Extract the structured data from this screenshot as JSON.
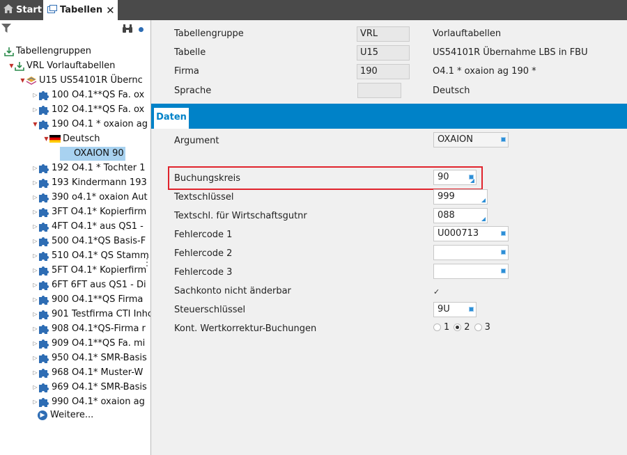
{
  "tabs": [
    {
      "label": "Start"
    },
    {
      "label": "Tabellen"
    }
  ],
  "tree": {
    "root": "Tabellengruppen",
    "vrl": "VRL  Vorlauftabellen",
    "u15": "U15  US54101R Übernc",
    "items_before": [
      "100 O4.1**QS Fa. ox",
      "102 O4.1**QS Fa. ox"
    ],
    "company_190": "190 O4.1 * oxaion ag",
    "deutsch": "Deutsch",
    "selected": "OXAION  90",
    "items_after": [
      "192 O4.1 * Tochter 1",
      "193 Kindermann 193",
      "390 o4.1* oxaion Aut",
      "3FT O4.1* Kopierfirm",
      "4FT O4.1* aus QS1 -",
      "500 O4.1*QS Basis-F",
      "510 O4.1* QS Stamm",
      "5FT O4.1* Kopierfirm",
      "6FT 6FT aus QS1 - Di",
      "900 O4.1**QS Firma",
      "901 Testfirma CTI Inhc",
      "908 O4.1*QS-Firma r",
      "909 O4.1**QS Fa. mi",
      "950 O4.1* SMR-Basis",
      "968 O4.1* Muster-W",
      "969 O4.1* SMR-Basis",
      "990 O4.1* oxaion ag"
    ],
    "more": "Weitere..."
  },
  "header": {
    "rows": [
      {
        "label": "Tabellengruppe",
        "value": "VRL",
        "desc": "Vorlauftabellen"
      },
      {
        "label": "Tabelle",
        "value": "U15",
        "desc": "US54101R Übernahme LBS in FBU"
      },
      {
        "label": "Firma",
        "value": "190",
        "desc": "O4.1 * oxaion ag 190   *"
      },
      {
        "label": "Sprache",
        "value": "",
        "desc": "Deutsch"
      }
    ]
  },
  "section_tab": "Daten",
  "form": {
    "argument": {
      "label": "Argument",
      "value": "OXAION"
    },
    "fields": [
      {
        "label": "Buchungskreis",
        "value": "90"
      },
      {
        "label": "Textschlüssel",
        "value": "999"
      },
      {
        "label": "Textschl. für Wirtschaftsgutnr",
        "value": "088"
      },
      {
        "label": "Fehlercode 1",
        "value": "U000713"
      },
      {
        "label": "Fehlercode 2",
        "value": ""
      },
      {
        "label": "Fehlercode 3",
        "value": ""
      }
    ],
    "sachkonto": {
      "label": "Sachkonto nicht änderbar",
      "checked": true
    },
    "steuer": {
      "label": "Steuerschlüssel",
      "value": "9U"
    },
    "kont": {
      "label": "Kont. Wertkorrektur-Buchungen",
      "options": [
        "1",
        "2",
        "3"
      ],
      "selected": "2"
    }
  },
  "colors": {
    "accent": "#0082c8",
    "highlight": "#e0232c",
    "selection": "#a8d2f0"
  }
}
